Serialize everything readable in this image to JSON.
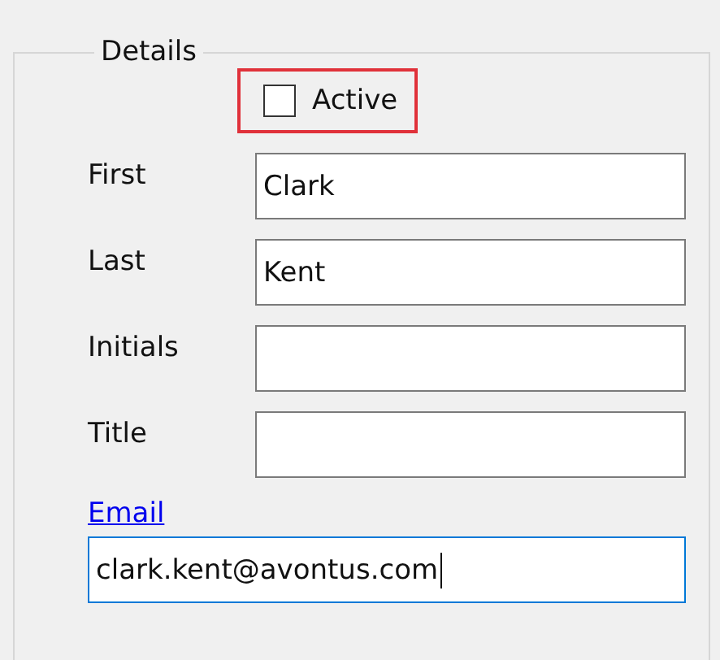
{
  "group": {
    "title": "Details"
  },
  "active": {
    "label": "Active",
    "checked": false
  },
  "fields": [
    {
      "label": "First",
      "value": "Clark"
    },
    {
      "label": "Last",
      "value": "Kent"
    },
    {
      "label": "Initials"
    },
    {
      "label": "Title"
    }
  ],
  "email": {
    "link": "Email",
    "value": "clark.kent@avontus.com",
    "focused": true
  }
}
